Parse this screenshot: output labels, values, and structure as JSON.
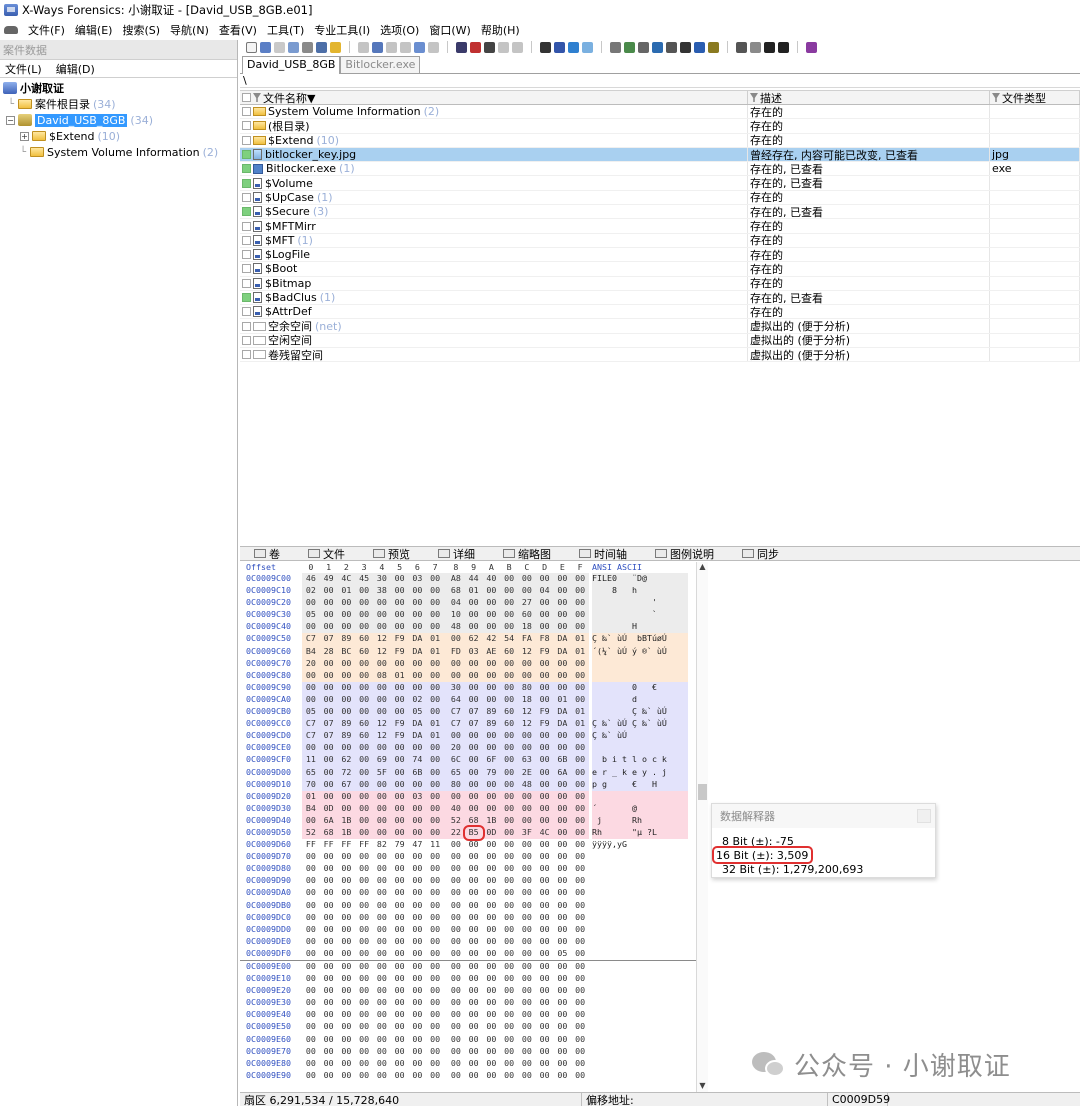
{
  "window": {
    "title": "X-Ways Forensics: 小谢取证 - [David_USB_8GB.e01]"
  },
  "menu": [
    "文件(F)",
    "编辑(E)",
    "搜索(S)",
    "导航(N)",
    "查看(V)",
    "工具(T)",
    "专业工具(I)",
    "选项(O)",
    "窗口(W)",
    "帮助(H)"
  ],
  "left_pane": {
    "header": "案件数据",
    "menu": [
      "文件(L)",
      "编辑(D)"
    ],
    "tree": {
      "case": "小谢取证",
      "root_dir": {
        "label": "案件根目录",
        "count": "(34)"
      },
      "drive": {
        "label": "David_USB_8GB",
        "count": "(34)"
      },
      "extend": {
        "label": "$Extend",
        "count": "(10)"
      },
      "svi": {
        "label": "System Volume Information",
        "count": "(2)"
      }
    }
  },
  "tabs": [
    {
      "label": "David_USB_8GB",
      "active": true
    },
    {
      "label": "Bitlocker.exe",
      "active": false
    }
  ],
  "path": "\\",
  "file_list": {
    "columns": {
      "name": "文件名称▼",
      "desc": "描述",
      "type": "文件类型"
    },
    "rows": [
      {
        "name": "System Volume Information",
        "count": "(2)",
        "desc": "存在的",
        "type": "",
        "icon": "folder",
        "check": "plain"
      },
      {
        "name": "(根目录)",
        "count": "",
        "desc": "存在的",
        "type": "",
        "icon": "folder",
        "check": "plain"
      },
      {
        "name": "$Extend",
        "count": "(10)",
        "desc": "存在的",
        "type": "",
        "icon": "folder",
        "check": "plain"
      },
      {
        "name": "bitlocker_key.jpg",
        "count": "",
        "desc": "曾经存在, 内容可能已改变, 已查看",
        "type": "jpg",
        "icon": "image",
        "check": "green"
      },
      {
        "name": "Bitlocker.exe",
        "count": "(1)",
        "desc": "存在的, 已查看",
        "type": "exe",
        "icon": "exe",
        "check": "green"
      },
      {
        "name": "$Volume",
        "count": "",
        "desc": "存在的, 已查看",
        "type": "",
        "icon": "sysfile",
        "check": "green"
      },
      {
        "name": "$UpCase",
        "count": "(1)",
        "desc": "存在的",
        "type": "",
        "icon": "sysfile",
        "check": "plain"
      },
      {
        "name": "$Secure",
        "count": "(3)",
        "desc": "存在的, 已查看",
        "type": "",
        "icon": "sysfile",
        "check": "green"
      },
      {
        "name": "$MFTMirr",
        "count": "",
        "desc": "存在的",
        "type": "",
        "icon": "sysfile",
        "check": "plain"
      },
      {
        "name": "$MFT",
        "count": "(1)",
        "desc": "存在的",
        "type": "",
        "icon": "sysfile",
        "check": "plain"
      },
      {
        "name": "$LogFile",
        "count": "",
        "desc": "存在的",
        "type": "",
        "icon": "sysfile",
        "check": "plain"
      },
      {
        "name": "$Boot",
        "count": "",
        "desc": "存在的",
        "type": "",
        "icon": "sysfile",
        "check": "plain"
      },
      {
        "name": "$Bitmap",
        "count": "",
        "desc": "存在的",
        "type": "",
        "icon": "sysfile",
        "check": "plain"
      },
      {
        "name": "$BadClus",
        "count": "(1)",
        "desc": "存在的, 已查看",
        "type": "",
        "icon": "sysfile",
        "check": "green"
      },
      {
        "name": "$AttrDef",
        "count": "",
        "desc": "存在的",
        "type": "",
        "icon": "sysfile",
        "check": "plain"
      },
      {
        "name": "空余空间",
        "count": "(net)",
        "desc": "虚拟出的 (便于分析)",
        "type": "",
        "icon": "virtual",
        "check": "plain"
      },
      {
        "name": "空闲空间",
        "count": "",
        "desc": "虚拟出的 (便于分析)",
        "type": "",
        "icon": "virtual",
        "check": "plain"
      },
      {
        "name": "卷残留空间",
        "count": "",
        "desc": "虚拟出的 (便于分析)",
        "type": "",
        "icon": "virtual",
        "check": "plain"
      }
    ],
    "selected_index": 3
  },
  "lower_tabs": [
    "卷",
    "文件",
    "预览",
    "详细",
    "缩略图",
    "时间轴",
    "图例说明",
    "同步"
  ],
  "hex": {
    "header_offset": "Offset",
    "header_cols": [
      "0",
      "1",
      "2",
      "3",
      "4",
      "5",
      "6",
      "7",
      "8",
      "9",
      "A",
      "B",
      "C",
      "D",
      "E",
      "F"
    ],
    "header_ascii": "ANSI ASCII",
    "rows": [
      {
        "off": "0C0009C00",
        "b": "46 49 4C 45 30 00 03 00 A8 44 40 00 00 00 00 00",
        "a": "FILE0   ¨D@     "
      },
      {
        "off": "0C0009C10",
        "b": "02 00 01 00 38 00 00 00 68 01 00 00 00 04 00 00",
        "a": "    8   h       "
      },
      {
        "off": "0C0009C20",
        "b": "00 00 00 00 00 00 00 00 04 00 00 00 27 00 00 00",
        "a": "            '   "
      },
      {
        "off": "0C0009C30",
        "b": "05 00 00 00 00 00 00 00 10 00 00 00 60 00 00 00",
        "a": "            `   "
      },
      {
        "off": "0C0009C40",
        "b": "00 00 00 00 00 00 00 00 48 00 00 00 18 00 00 00",
        "a": "        H       "
      },
      {
        "off": "0C0009C50",
        "b": "C7 07 89 60 12 F9 DA 01 00 62 42 54 FA F8 DA 01",
        "a": "Ç ‰` ùÚ  bBTúøÚ "
      },
      {
        "off": "0C0009C60",
        "b": "B4 28 BC 60 12 F9 DA 01 FD 03 AE 60 12 F9 DA 01",
        "a": "´(¼` ùÚ ý ®` ùÚ "
      },
      {
        "off": "0C0009C70",
        "b": "20 00 00 00 00 00 00 00 00 00 00 00 00 00 00 00",
        "a": "                "
      },
      {
        "off": "0C0009C80",
        "b": "00 00 00 00 08 01 00 00 00 00 00 00 00 00 00 00",
        "a": "                "
      },
      {
        "off": "0C0009C90",
        "b": "00 00 00 00 00 00 00 00 30 00 00 00 80 00 00 00",
        "a": "        0   €   "
      },
      {
        "off": "0C0009CA0",
        "b": "00 00 00 00 00 00 02 00 64 00 00 00 18 00 01 00",
        "a": "        d       "
      },
      {
        "off": "0C0009CB0",
        "b": "05 00 00 00 00 00 05 00 C7 07 89 60 12 F9 DA 01",
        "a": "        Ç ‰` ùÚ "
      },
      {
        "off": "0C0009CC0",
        "b": "C7 07 89 60 12 F9 DA 01 C7 07 89 60 12 F9 DA 01",
        "a": "Ç ‰` ùÚ Ç ‰` ùÚ "
      },
      {
        "off": "0C0009CD0",
        "b": "C7 07 89 60 12 F9 DA 01 00 00 00 00 00 00 00 00",
        "a": "Ç ‰` ùÚ         "
      },
      {
        "off": "0C0009CE0",
        "b": "00 00 00 00 00 00 00 00 20 00 00 00 00 00 00 00",
        "a": "                "
      },
      {
        "off": "0C0009CF0",
        "b": "11 00 62 00 69 00 74 00 6C 00 6F 00 63 00 6B 00",
        "a": "  b i t l o c k "
      },
      {
        "off": "0C0009D00",
        "b": "65 00 72 00 5F 00 6B 00 65 00 79 00 2E 00 6A 00",
        "a": "e r _ k e y . j "
      },
      {
        "off": "0C0009D10",
        "b": "70 00 67 00 00 00 00 00 80 00 00 00 48 00 00 00",
        "a": "p g     €   H   "
      },
      {
        "off": "0C0009D20",
        "b": "01 00 00 00 00 00 03 00 00 00 00 00 00 00 00 00",
        "a": "                "
      },
      {
        "off": "0C0009D30",
        "b": "B4 0D 00 00 00 00 00 00 40 00 00 00 00 00 00 00",
        "a": "´       @       "
      },
      {
        "off": "0C0009D40",
        "b": "00 6A 1B 00 00 00 00 00 52 68 1B 00 00 00 00 00",
        "a": " j      Rh      "
      },
      {
        "off": "0C0009D50",
        "b": "52 68 1B 00 00 00 00 00 22 B5 0D 00 3F 4C 00 00",
        "a": "Rh      \"µ ?L  "
      },
      {
        "off": "0C0009D60",
        "b": "FF FF FF FF 82 79 47 11 00 00 00 00 00 00 00 00",
        "a": "ÿÿÿÿ‚yG         "
      },
      {
        "off": "0C0009D70",
        "b": "00 00 00 00 00 00 00 00 00 00 00 00 00 00 00 00",
        "a": ""
      },
      {
        "off": "0C0009D80",
        "b": "00 00 00 00 00 00 00 00 00 00 00 00 00 00 00 00",
        "a": ""
      },
      {
        "off": "0C0009D90",
        "b": "00 00 00 00 00 00 00 00 00 00 00 00 00 00 00 00",
        "a": ""
      },
      {
        "off": "0C0009DA0",
        "b": "00 00 00 00 00 00 00 00 00 00 00 00 00 00 00 00",
        "a": ""
      },
      {
        "off": "0C0009DB0",
        "b": "00 00 00 00 00 00 00 00 00 00 00 00 00 00 00 00",
        "a": ""
      },
      {
        "off": "0C0009DC0",
        "b": "00 00 00 00 00 00 00 00 00 00 00 00 00 00 00 00",
        "a": ""
      },
      {
        "off": "0C0009DD0",
        "b": "00 00 00 00 00 00 00 00 00 00 00 00 00 00 00 00",
        "a": ""
      },
      {
        "off": "0C0009DE0",
        "b": "00 00 00 00 00 00 00 00 00 00 00 00 00 00 00 00",
        "a": ""
      },
      {
        "off": "0C0009DF0",
        "b": "00 00 00 00 00 00 00 00 00 00 00 00 00 00 05 00",
        "a": ""
      },
      {
        "off": "0C0009E00",
        "b": "00 00 00 00 00 00 00 00 00 00 00 00 00 00 00 00",
        "a": ""
      },
      {
        "off": "0C0009E10",
        "b": "00 00 00 00 00 00 00 00 00 00 00 00 00 00 00 00",
        "a": ""
      },
      {
        "off": "0C0009E20",
        "b": "00 00 00 00 00 00 00 00 00 00 00 00 00 00 00 00",
        "a": ""
      },
      {
        "off": "0C0009E30",
        "b": "00 00 00 00 00 00 00 00 00 00 00 00 00 00 00 00",
        "a": ""
      },
      {
        "off": "0C0009E40",
        "b": "00 00 00 00 00 00 00 00 00 00 00 00 00 00 00 00",
        "a": ""
      },
      {
        "off": "0C0009E50",
        "b": "00 00 00 00 00 00 00 00 00 00 00 00 00 00 00 00",
        "a": ""
      },
      {
        "off": "0C0009E60",
        "b": "00 00 00 00 00 00 00 00 00 00 00 00 00 00 00 00",
        "a": ""
      },
      {
        "off": "0C0009E70",
        "b": "00 00 00 00 00 00 00 00 00 00 00 00 00 00 00 00",
        "a": ""
      },
      {
        "off": "0C0009E80",
        "b": "00 00 00 00 00 00 00 00 00 00 00 00 00 00 00 00",
        "a": ""
      },
      {
        "off": "0C0009E90",
        "b": "00 00 00 00 00 00 00 00 00 00 00 00 00 00 00 00",
        "a": ""
      }
    ],
    "marked_byte": {
      "row": 21,
      "col": 9
    }
  },
  "interpreter": {
    "title": "数据解释器",
    "rows": [
      {
        "label": "8 Bit (±): -75",
        "highlight": false
      },
      {
        "label": "16 Bit (±): 3,509",
        "highlight": true
      },
      {
        "label": "32 Bit (±): 1,279,200,693",
        "highlight": false
      }
    ]
  },
  "status": {
    "sector": "扇区 6,291,534 / 15,728,640",
    "offset_label": "偏移地址:",
    "offset_value": "C0009D59"
  },
  "watermark": "公众号 · 小谢取证",
  "colors": {
    "selection_blue": "#3399ff",
    "selected_row": "#a9d0f0",
    "offset_blue": "#3050c0",
    "highlight_red": "#e03030"
  }
}
